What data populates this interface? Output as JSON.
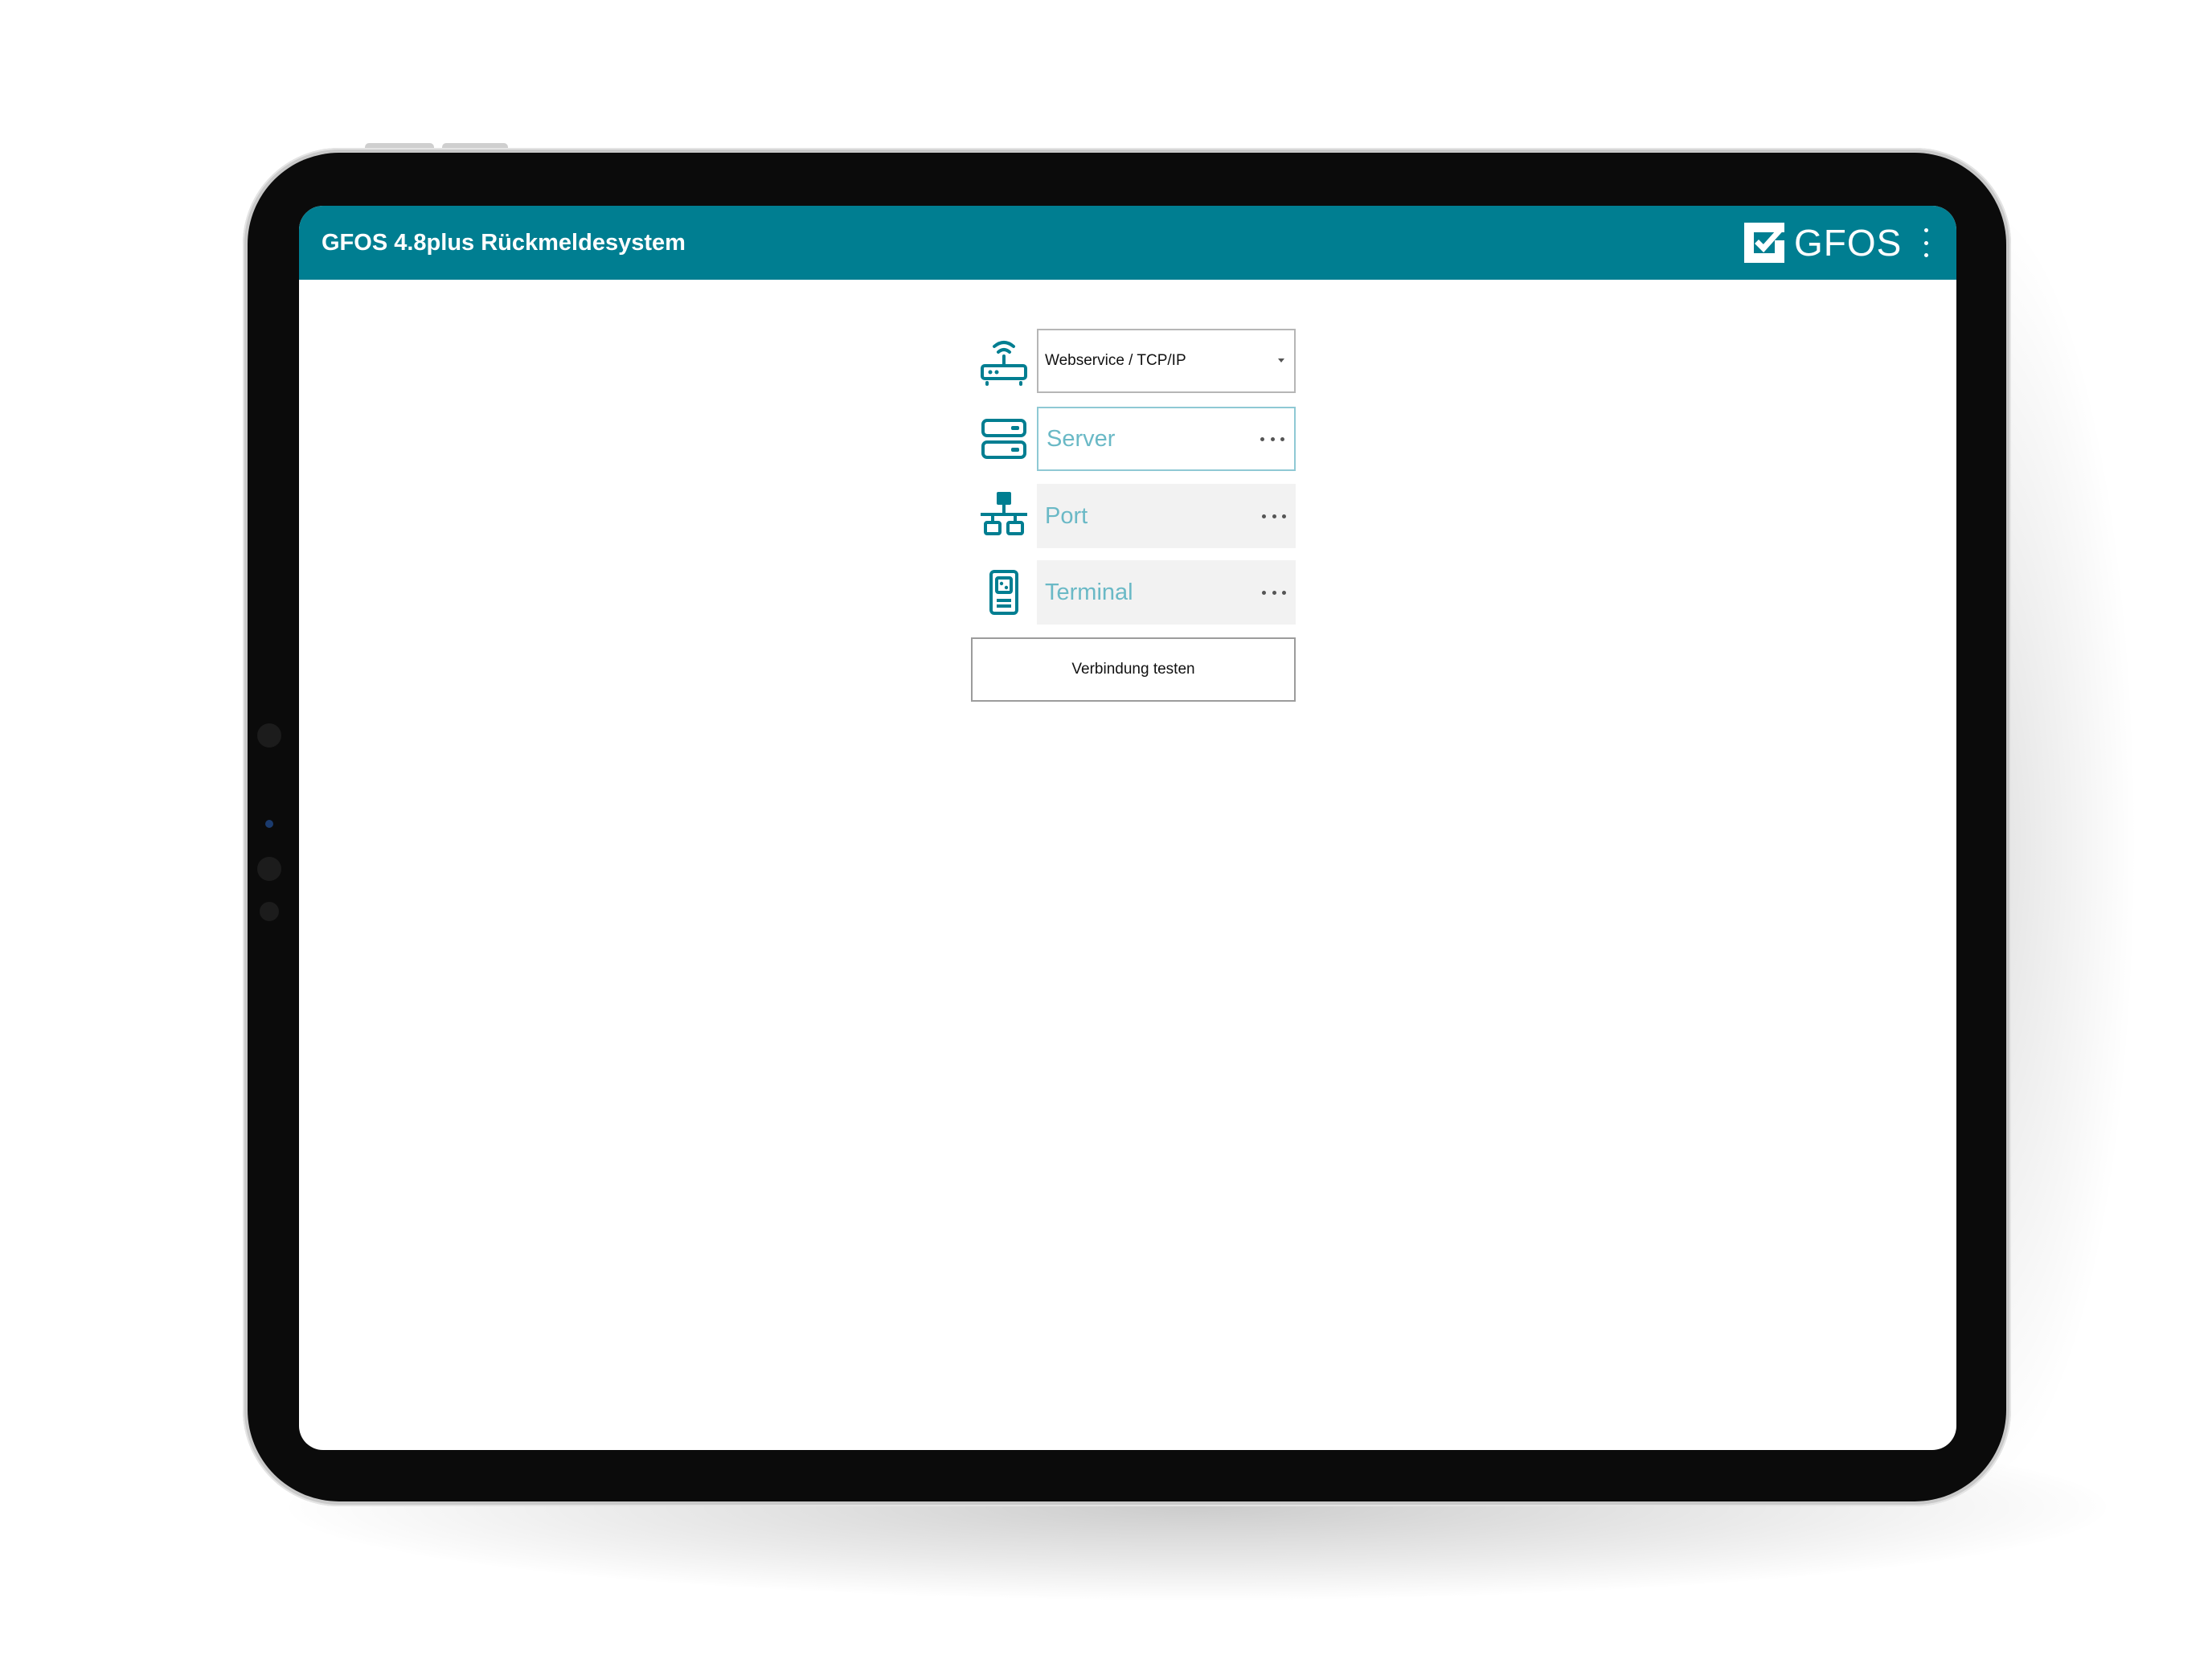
{
  "app": {
    "title": "GFOS 4.8plus Rückmeldesystem",
    "logo_text": "GFOS",
    "accent_color": "#007e91"
  },
  "form": {
    "connection_type": {
      "icon": "router-icon",
      "value": "Webservice / TCP/IP"
    },
    "server": {
      "icon": "server-icon",
      "placeholder": "Server",
      "value": ""
    },
    "port": {
      "icon": "network-icon",
      "placeholder": "Port",
      "value": ""
    },
    "terminal": {
      "icon": "terminal-device-icon",
      "placeholder": "Terminal",
      "value": ""
    },
    "test_button_label": "Verbindung testen"
  }
}
